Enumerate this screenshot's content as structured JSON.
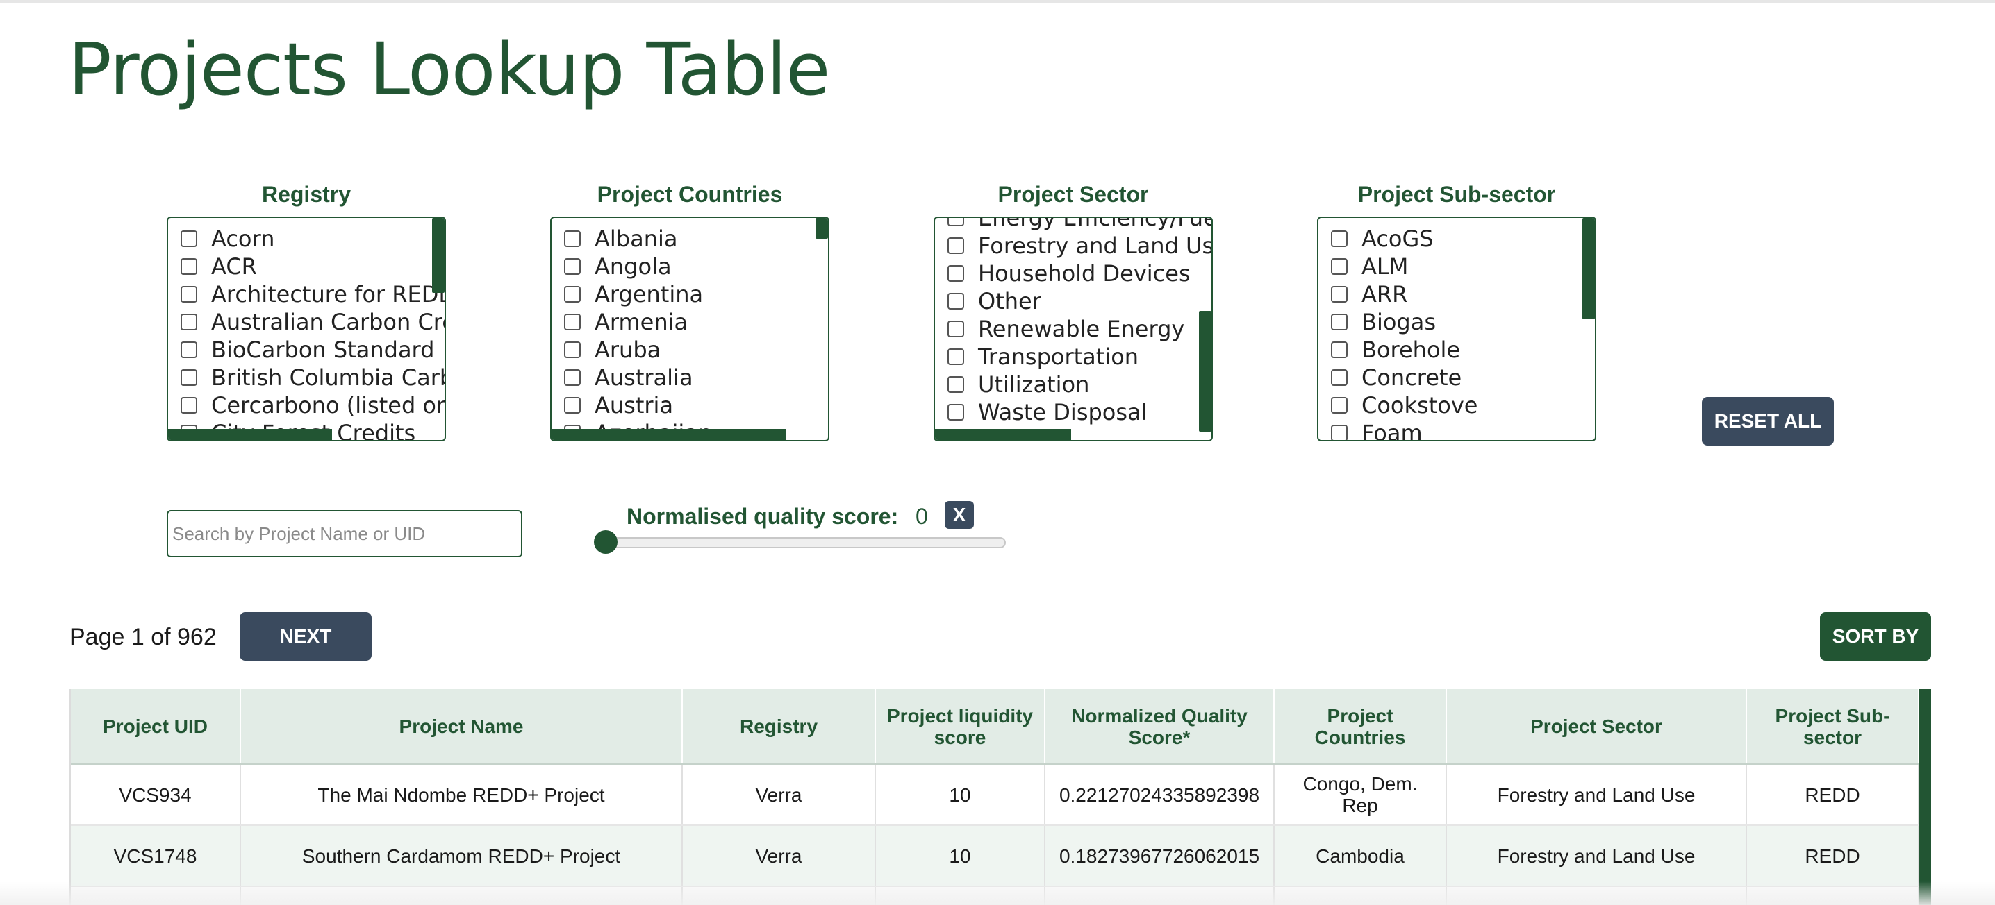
{
  "page": {
    "title": "Projects Lookup Table"
  },
  "filters": [
    {
      "heading": "Registry",
      "items": [
        "Acorn",
        "ACR",
        "Architecture for REDD+ Transactions",
        "Australian Carbon Credit Units",
        "BioCarbon Standard",
        "British Columbia Carbon Registry",
        "Cercarbono (listed on EcoRegistry)",
        "City Forest Credits"
      ]
    },
    {
      "heading": "Project Countries",
      "items": [
        "Albania",
        "Angola",
        "Argentina",
        "Armenia",
        "Aruba",
        "Australia",
        "Austria",
        "Azerbaijan"
      ]
    },
    {
      "heading": "Project Sector",
      "items": [
        "Energy Efficiency/Fuel Switching",
        "Forestry and Land Use",
        "Household Devices",
        "Other",
        "Renewable Energy",
        "Transportation",
        "Utilization",
        "Waste Disposal"
      ]
    },
    {
      "heading": "Project Sub-sector",
      "items": [
        "AcoGS",
        "ALM",
        "ARR",
        "Biogas",
        "Borehole",
        "Concrete",
        "Cookstove",
        "Foam"
      ]
    }
  ],
  "controls": {
    "reset_label": "RESET ALL",
    "search_placeholder": "Search by Project Name or UID",
    "score_label": "Normalised quality score:",
    "score_value": "0",
    "score_clear_label": "X",
    "score_slider_fraction": 0
  },
  "pagination": {
    "indicator": "Page 1 of 962",
    "next_label": "NEXT",
    "sort_label": "SORT BY"
  },
  "table": {
    "headers": [
      "Project UID",
      "Project Name",
      "Registry",
      "Project liquidity score",
      "Normalized Quality Score*",
      "Project Countries",
      "Project Sector",
      "Project Sub-sector"
    ],
    "rows": [
      [
        "VCS934",
        "The Mai Ndombe REDD+ Project",
        "Verra",
        "10",
        "0.22127024335892398",
        "Congo, Dem. Rep",
        "Forestry and Land Use",
        "REDD"
      ],
      [
        "VCS1748",
        "Southern Cardamom REDD+ Project",
        "Verra",
        "10",
        "0.18273967726062015",
        "Cambodia",
        "Forestry and Land Use",
        "REDD"
      ]
    ]
  },
  "colors": {
    "brand_green": "#225533",
    "button_slate": "#3a4a5e",
    "header_row_bg": "#e2ece6"
  }
}
